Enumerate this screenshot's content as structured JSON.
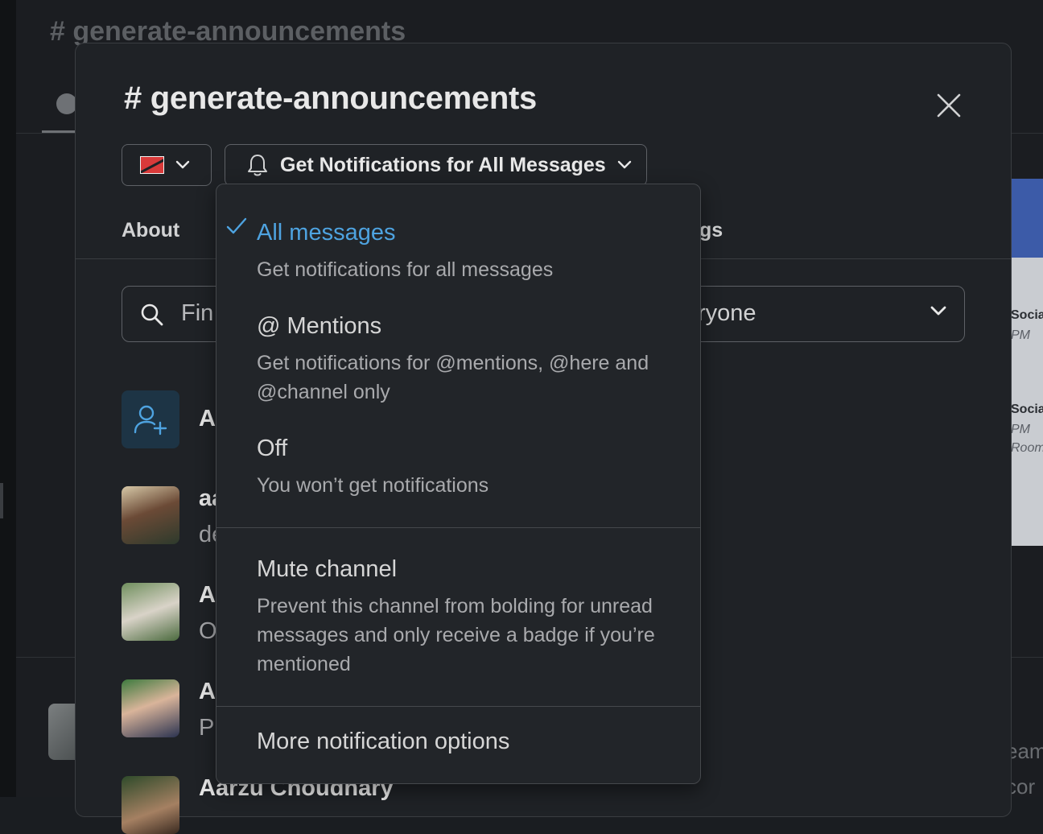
{
  "background": {
    "channel_title": "# generate-announcements",
    "card_text": [
      "Socia",
      "PM",
      "Socia",
      "PM",
      "Room"
    ],
    "right_text": [
      "eam",
      "cor"
    ]
  },
  "modal": {
    "title": "# generate-announcements",
    "notif_button_label": "Get Notifications for All Messages",
    "tabs": {
      "about": "About",
      "settings_fragment": "gs"
    },
    "search": {
      "placeholder": "Fin"
    },
    "filter": {
      "value": "ryone"
    },
    "members": [
      {
        "name": "Ac",
        "sub": ""
      },
      {
        "name": "aa",
        "sub": "de"
      },
      {
        "name": "Aa",
        "sub": "O"
      },
      {
        "name": "Aa",
        "sub": "Pl"
      },
      {
        "name": "Aarzu Choudhary",
        "sub": ""
      }
    ]
  },
  "menu": {
    "options": [
      {
        "title": "All messages",
        "desc": "Get notifications for all messages",
        "selected": true
      },
      {
        "title": "@ Mentions",
        "desc": "Get notifications for @mentions, @here and @channel only",
        "selected": false
      },
      {
        "title": "Off",
        "desc": "You won’t get notifications",
        "selected": false
      }
    ],
    "mute": {
      "title": "Mute channel",
      "desc": "Prevent this channel from bolding for unread messages and only receive a badge if you’re mentioned"
    },
    "more": "More notification options"
  },
  "colors": {
    "accent": "#4ea3e0",
    "modal_bg": "#1f2226",
    "menu_bg": "#222529"
  }
}
